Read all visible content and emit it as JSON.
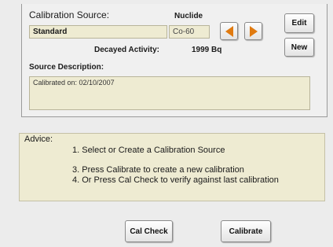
{
  "source_panel": {
    "calibration_source_label": "Calibration Source:",
    "calibration_source_value": "Standard",
    "nuclide_label": "Nuclide",
    "nuclide_value": "Co-60",
    "decayed_activity_label": "Decayed Activity:",
    "decayed_activity_value": "1999 Bq",
    "source_description_label": "Source Description:",
    "source_description_value": "Calibrated on: 02/10/2007",
    "edit_label": "Edit",
    "new_label": "New",
    "prev_icon": "left-arrow-icon",
    "next_icon": "right-arrow-icon",
    "arrow_color": "#e07a10"
  },
  "advice": {
    "title": "Advice:",
    "lines": [
      "1.  Select or Create a Calibration Source",
      "3.  Press Calibrate to create a new calibration",
      "4.  Or Press Cal Check to verify against last calibration"
    ]
  },
  "actions": {
    "cal_check_label": "Cal Check",
    "calibrate_label": "Calibrate"
  }
}
